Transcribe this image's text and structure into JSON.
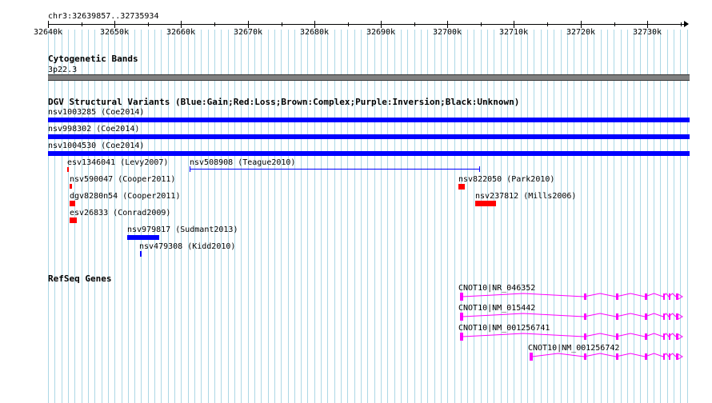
{
  "location": "chr3:32639857..32735934",
  "ruler": {
    "tick_labels": [
      "32640k",
      "32650k",
      "32660k",
      "32670k",
      "32680k",
      "32690k",
      "32700k",
      "32710k",
      "32720k",
      "32730k"
    ]
  },
  "tracks": {
    "cytoband": {
      "title": "Cytogenetic Bands",
      "band_label": "3p22.3"
    },
    "dgv": {
      "title": "DGV Structural Variants (Blue:Gain;Red:Loss;Brown:Complex;Purple:Inversion;Black:Unknown)",
      "colors": {
        "gain": "#0000ff",
        "loss": "#ff0000",
        "complex": "#8b4513",
        "inversion": "#800080",
        "unknown": "#000000"
      },
      "features": [
        {
          "label": "nsv1003285 (Coe2014)",
          "type": "gain"
        },
        {
          "label": "nsv998302 (Coe2014)",
          "type": "gain"
        },
        {
          "label": "nsv1004530 (Coe2014)",
          "type": "gain"
        },
        {
          "label": "esv1346041 (Levy2007)",
          "type": "loss"
        },
        {
          "label": "nsv508908 (Teague2010)",
          "type": "gain"
        },
        {
          "label": "nsv590047 (Cooper2011)",
          "type": "loss"
        },
        {
          "label": "nsv822050 (Park2010)",
          "type": "loss"
        },
        {
          "label": "dgv8280n54 (Cooper2011)",
          "type": "loss"
        },
        {
          "label": "nsv237812 (Mills2006)",
          "type": "loss"
        },
        {
          "label": "esv26833 (Conrad2009)",
          "type": "loss"
        },
        {
          "label": "nsv979817 (Sudmant2013)",
          "type": "gain"
        },
        {
          "label": "nsv479308 (Kidd2010)",
          "type": "gain"
        }
      ]
    },
    "refseq": {
      "title": "RefSeq Genes",
      "color": "#ff00ff",
      "genes": [
        {
          "label": "CNOT10|NR_046352"
        },
        {
          "label": "CNOT10|NM_015442"
        },
        {
          "label": "CNOT10|NM_001256741"
        },
        {
          "label": "CNOT10|NM_001256742"
        }
      ]
    }
  }
}
